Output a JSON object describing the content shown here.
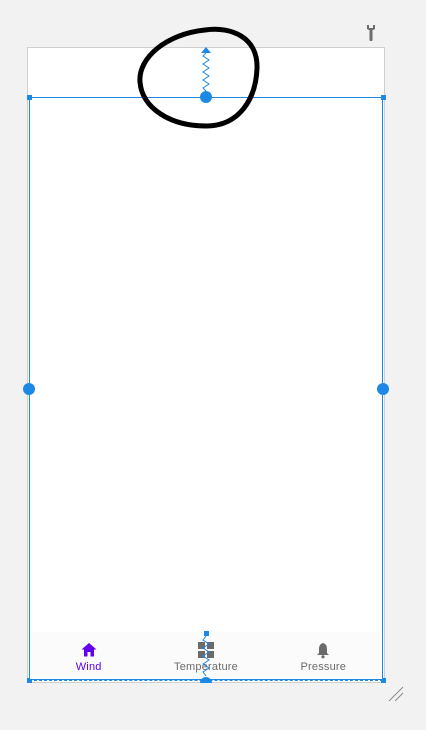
{
  "colors": {
    "canvas_bg": "#f2f2f2",
    "device_bg": "#ffffff",
    "selection": "#1e88e5",
    "active": "#6200ee",
    "inactive": "#6b6b6b",
    "annotation": "#000000"
  },
  "toolbar": {
    "tools_icon": "wrench-icon"
  },
  "bottom_nav": {
    "items": [
      {
        "label": "Wind",
        "icon": "home-icon",
        "active": true
      },
      {
        "label": "Temperature",
        "icon": "grid-icon",
        "active": false
      },
      {
        "label": "Pressure",
        "icon": "bell-icon",
        "active": false
      }
    ]
  },
  "annotation": {
    "shape": "hand-drawn-circle"
  }
}
